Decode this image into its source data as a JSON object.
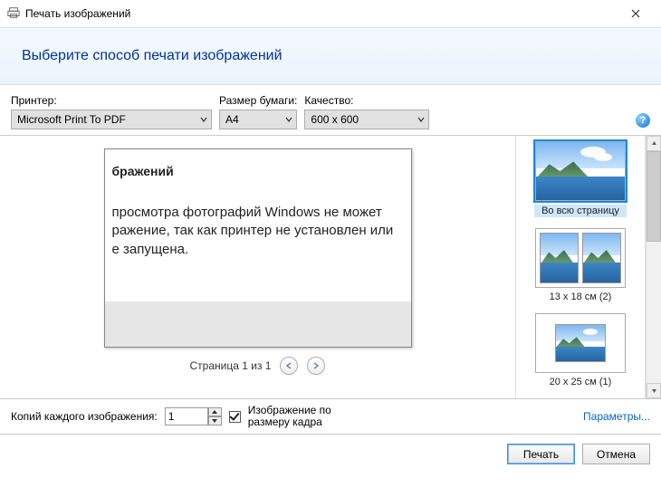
{
  "titlebar": {
    "title": "Печать изображений"
  },
  "header": {
    "heading": "Выберите способ печати изображений"
  },
  "controls": {
    "printer": {
      "label": "Принтер:",
      "value": "Microsoft Print To PDF"
    },
    "paper": {
      "label": "Размер бумаги:",
      "value": "A4"
    },
    "quality": {
      "label": "Качество:",
      "value": "600 x 600"
    }
  },
  "preview": {
    "title_fragment": "бражений",
    "body_line1": " просмотра фотографий Windows не может",
    "body_line2": "ражение, так как принтер не установлен или",
    "body_line3": "е запущена.",
    "pager_text": "Страница 1 из 1"
  },
  "layouts": [
    {
      "label": "Во всю страницу",
      "selected": true,
      "type": "full"
    },
    {
      "label": "13 x 18 см (2)",
      "selected": false,
      "type": "double"
    },
    {
      "label": "20 x 25 см (1)",
      "selected": false,
      "type": "single"
    }
  ],
  "bottom": {
    "copies_label": "Копий каждого изображения:",
    "copies_value": "1",
    "fit_label_l1": "Изображение по",
    "fit_label_l2": "размеру кадра",
    "fit_checked": true,
    "params_link": "Параметры..."
  },
  "actions": {
    "print": "Печать",
    "cancel": "Отмена"
  }
}
